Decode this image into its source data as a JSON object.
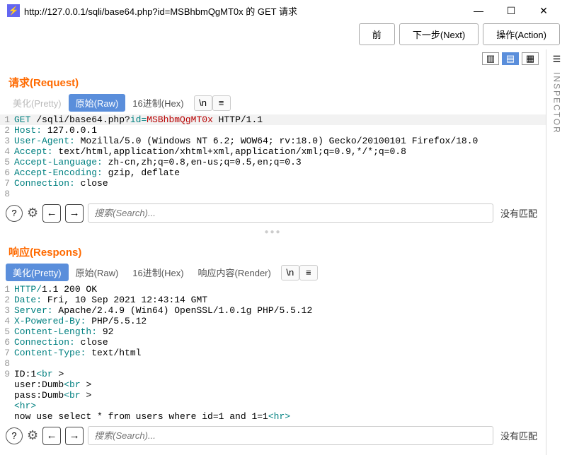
{
  "window": {
    "title": "http://127.0.0.1/sqli/base64.php?id=MSBhbmQgMT0x 的 GET 请求",
    "min": "—",
    "max": "☐",
    "close": "✕"
  },
  "toolbar": {
    "prev": "前",
    "next": "下一步(Next)",
    "action": "操作(Action)"
  },
  "request": {
    "title": "请求(Request)",
    "tabs": {
      "pretty": "美化(Pretty)",
      "raw": "原始(Raw)",
      "hex": "16进制(Hex)",
      "lf": "\\n"
    },
    "lines": [
      {
        "n": 1,
        "seg": [
          [
            "kw",
            "GET "
          ],
          [
            "",
            "/sqli/base64.php?"
          ],
          [
            "kw",
            "id="
          ],
          [
            "val",
            "MSBhbmQgMT0x"
          ],
          [
            "",
            " HTTP/1.1"
          ]
        ],
        "hl": true
      },
      {
        "n": 2,
        "seg": [
          [
            "kw",
            "Host:"
          ],
          [
            "",
            " 127.0.0.1"
          ]
        ]
      },
      {
        "n": 3,
        "seg": [
          [
            "kw",
            "User-Agent:"
          ],
          [
            "",
            " Mozilla/5.0 (Windows NT 6.2; WOW64; rv:18.0) Gecko/20100101 Firefox/18.0"
          ]
        ]
      },
      {
        "n": 4,
        "seg": [
          [
            "kw",
            "Accept:"
          ],
          [
            "",
            " text/html,application/xhtml+xml,application/xml;q=0.9,*/*;q=0.8"
          ]
        ]
      },
      {
        "n": 5,
        "seg": [
          [
            "kw",
            "Accept-Language:"
          ],
          [
            "",
            " zh-cn,zh;q=0.8,en-us;q=0.5,en;q=0.3"
          ]
        ]
      },
      {
        "n": 6,
        "seg": [
          [
            "kw",
            "Accept-Encoding:"
          ],
          [
            "",
            " gzip, deflate"
          ]
        ]
      },
      {
        "n": 7,
        "seg": [
          [
            "kw",
            "Connection:"
          ],
          [
            "",
            " close"
          ]
        ]
      },
      {
        "n": 8,
        "seg": [
          [
            "",
            ""
          ]
        ]
      }
    ],
    "search_ph": "搜索(Search)...",
    "nomatch": "没有匹配"
  },
  "response": {
    "title": "响应(Respons)",
    "tabs": {
      "pretty": "美化(Pretty)",
      "raw": "原始(Raw)",
      "hex": "16进制(Hex)",
      "render": "响应内容(Render)",
      "lf": "\\n"
    },
    "lines": [
      {
        "n": 1,
        "seg": [
          [
            "kw",
            "HTTP/"
          ],
          [
            "",
            "1.1 200 OK"
          ]
        ]
      },
      {
        "n": 2,
        "seg": [
          [
            "kw",
            "Date:"
          ],
          [
            "",
            " Fri, 10 Sep 2021 12:43:14 GMT"
          ]
        ]
      },
      {
        "n": 3,
        "seg": [
          [
            "kw",
            "Server:"
          ],
          [
            "",
            " Apache/2.4.9 (Win64) OpenSSL/1.0.1g PHP/5.5.12"
          ]
        ]
      },
      {
        "n": 4,
        "seg": [
          [
            "kw",
            "X-Powered-By:"
          ],
          [
            "",
            " PHP/5.5.12"
          ]
        ]
      },
      {
        "n": 5,
        "seg": [
          [
            "kw",
            "Content-Length:"
          ],
          [
            "",
            " 92"
          ]
        ]
      },
      {
        "n": 6,
        "seg": [
          [
            "kw",
            "Connection:"
          ],
          [
            "",
            " close"
          ]
        ]
      },
      {
        "n": 7,
        "seg": [
          [
            "kw",
            "Content-Type:"
          ],
          [
            "",
            " text/html"
          ]
        ]
      },
      {
        "n": 8,
        "seg": [
          [
            "",
            ""
          ]
        ]
      },
      {
        "n": 9,
        "seg": [
          [
            "",
            "ID:1"
          ],
          [
            "tag",
            "<br "
          ],
          [
            "",
            ">"
          ]
        ]
      },
      {
        "n": "",
        "seg": [
          [
            "",
            "user:Dumb"
          ],
          [
            "tag",
            "<br "
          ],
          [
            "",
            ">"
          ]
        ]
      },
      {
        "n": "",
        "seg": [
          [
            "",
            "pass:Dumb"
          ],
          [
            "tag",
            "<br "
          ],
          [
            "",
            ">"
          ]
        ]
      },
      {
        "n": "",
        "seg": [
          [
            "tag",
            "<hr>"
          ]
        ]
      },
      {
        "n": "",
        "seg": [
          [
            "",
            "now use select * from users where id=1 and 1=1"
          ],
          [
            "tag",
            "<hr>"
          ]
        ]
      }
    ],
    "search_ph": "搜索(Search)...",
    "nomatch": "没有匹配"
  },
  "inspector": {
    "label": "INSPECTOR"
  }
}
